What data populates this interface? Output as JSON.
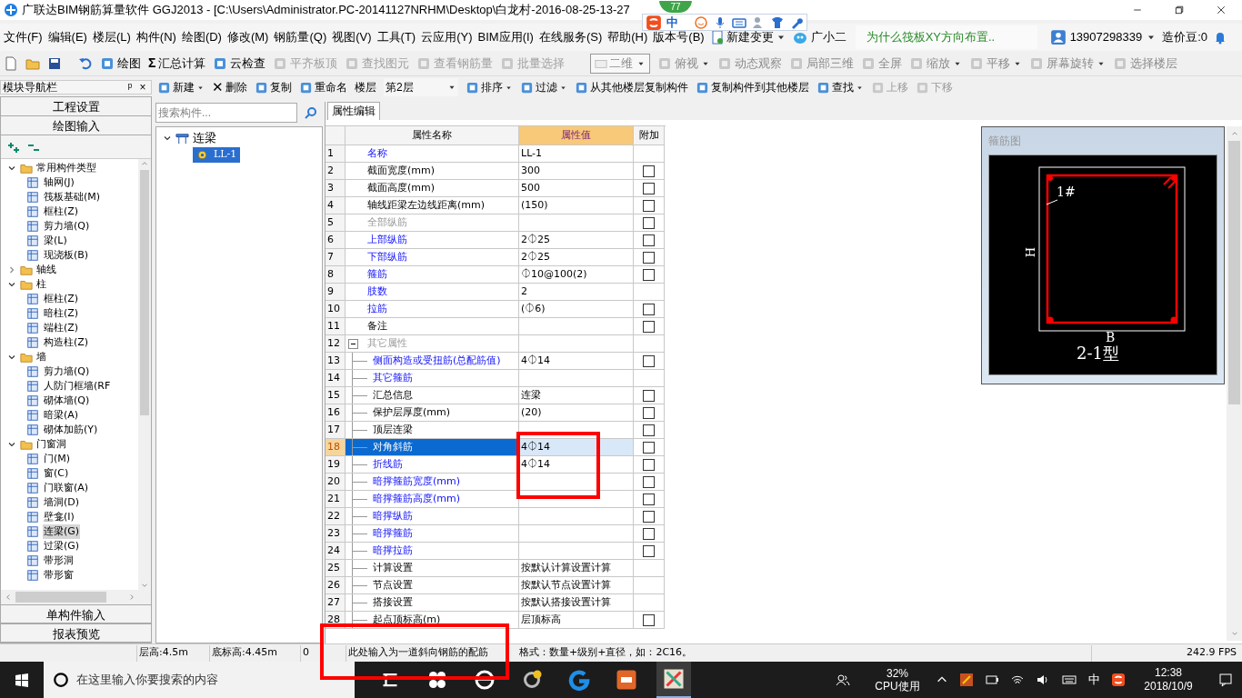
{
  "window": {
    "title": "广联达BIM钢筋算量软件 GGJ2013 - [C:\\Users\\Administrator.PC-20141127NRHM\\Desktop\\白龙村-2016-08-25-13-27"
  },
  "ime_bar": {
    "mode": "中",
    "badge": "77"
  },
  "menu": [
    {
      "label": "文件(F)"
    },
    {
      "label": "编辑(E)"
    },
    {
      "label": "楼层(L)"
    },
    {
      "label": "构件(N)"
    },
    {
      "label": "绘图(D)"
    },
    {
      "label": "修改(M)"
    },
    {
      "label": "钢筋量(Q)"
    },
    {
      "label": "视图(V)"
    },
    {
      "label": "工具(T)"
    },
    {
      "label": "云应用(Y)"
    },
    {
      "label": "BIM应用(I)"
    },
    {
      "label": "在线服务(S)"
    },
    {
      "label": "帮助(H)"
    },
    {
      "label": "版本号(B)"
    }
  ],
  "menu_extra": {
    "change": "新建变更",
    "assistant": "广小二",
    "news": "为什么筏板XY方向布置..",
    "account": "13907298339",
    "beans": "造价豆:0"
  },
  "toolbar": [
    {
      "label": "绘图",
      "disabled": false
    },
    {
      "label": "汇总计算",
      "glyph": "Σ",
      "disabled": false
    },
    {
      "label": "云检查",
      "disabled": false
    },
    {
      "label": "平齐板顶",
      "disabled": true
    },
    {
      "label": "查找图元",
      "disabled": true
    },
    {
      "label": "查看钢筋量",
      "disabled": true
    },
    {
      "label": "批量选择",
      "disabled": true
    }
  ],
  "view_toolbar": {
    "view_mode": "二维",
    "items": [
      {
        "label": "俯视",
        "dropdown": true
      },
      {
        "label": "动态观察",
        "dropdown": false
      },
      {
        "label": "局部三维",
        "dropdown": false
      },
      {
        "label": "全屏",
        "dropdown": false
      },
      {
        "label": "缩放",
        "dropdown": true
      },
      {
        "label": "平移",
        "dropdown": true
      },
      {
        "label": "屏幕旋转",
        "dropdown": true
      },
      {
        "label": "选择楼层",
        "dropdown": false
      }
    ]
  },
  "component_toolbar": [
    {
      "kind": "button",
      "label": "新建",
      "dropdown": true,
      "disabled": false
    },
    {
      "kind": "button",
      "label": "删除",
      "glyph": "✕",
      "dropdown": false,
      "disabled": false
    },
    {
      "kind": "button",
      "label": "复制",
      "dropdown": false,
      "disabled": false
    },
    {
      "kind": "button",
      "label": "重命名",
      "dropdown": false,
      "disabled": false
    },
    {
      "kind": "floor",
      "label": "楼层",
      "value": "第2层"
    },
    {
      "kind": "button",
      "label": "排序",
      "dropdown": true,
      "disabled": false
    },
    {
      "kind": "button",
      "label": "过滤",
      "dropdown": true,
      "disabled": false
    },
    {
      "kind": "button",
      "label": "从其他楼层复制构件",
      "dropdown": false,
      "disabled": false
    },
    {
      "kind": "button",
      "label": "复制构件到其他楼层",
      "dropdown": false,
      "disabled": false
    },
    {
      "kind": "button",
      "label": "查找",
      "dropdown": true,
      "disabled": false
    },
    {
      "kind": "button",
      "label": "上移",
      "dropdown": false,
      "disabled": true
    },
    {
      "kind": "button",
      "label": "下移",
      "dropdown": false,
      "disabled": true
    }
  ],
  "nav": {
    "title": "模块导航栏",
    "pin": "ᵖ",
    "close": "×",
    "top_buttons": [
      "工程设置",
      "绘图输入"
    ],
    "bottom_buttons": [
      "单构件输入",
      "报表预览"
    ],
    "tree": [
      {
        "label": "常用构件类型",
        "expanded": true,
        "selected": false,
        "children": [
          {
            "label": "轴网(J)",
            "selected": false
          },
          {
            "label": "筏板基础(M)",
            "selected": false
          },
          {
            "label": "框柱(Z)",
            "selected": false
          },
          {
            "label": "剪力墙(Q)",
            "selected": false
          },
          {
            "label": "梁(L)",
            "selected": false
          },
          {
            "label": "现浇板(B)",
            "selected": false
          }
        ]
      },
      {
        "label": "轴线",
        "expanded": false,
        "selected": false
      },
      {
        "label": "柱",
        "expanded": true,
        "selected": false,
        "children": [
          {
            "label": "框柱(Z)",
            "selected": false
          },
          {
            "label": "暗柱(Z)",
            "selected": false
          },
          {
            "label": "端柱(Z)",
            "selected": false
          },
          {
            "label": "构造柱(Z)",
            "selected": false
          }
        ]
      },
      {
        "label": "墙",
        "expanded": true,
        "selected": false,
        "children": [
          {
            "label": "剪力墙(Q)",
            "selected": false
          },
          {
            "label": "人防门框墙(RF",
            "selected": false
          },
          {
            "label": "砌体墙(Q)",
            "selected": false
          },
          {
            "label": "暗梁(A)",
            "selected": false
          },
          {
            "label": "砌体加筋(Y)",
            "selected": false
          }
        ]
      },
      {
        "label": "门窗洞",
        "expanded": true,
        "selected": false,
        "children": [
          {
            "label": "门(M)",
            "selected": false
          },
          {
            "label": "窗(C)",
            "selected": false
          },
          {
            "label": "门联窗(A)",
            "selected": false
          },
          {
            "label": "墙洞(D)",
            "selected": false
          },
          {
            "label": "壁龛(I)",
            "selected": false
          },
          {
            "label": "连梁(G)",
            "selected": true
          },
          {
            "label": "过梁(G)",
            "selected": false
          },
          {
            "label": "带形洞",
            "selected": false
          },
          {
            "label": "带形窗",
            "selected": false
          }
        ]
      }
    ]
  },
  "components": {
    "search": {
      "placeholder": "搜索构件..."
    },
    "tree": [
      {
        "label": "连梁",
        "expanded": true,
        "selected": false,
        "children": [
          {
            "label": "LL-1",
            "selected": true
          }
        ]
      }
    ]
  },
  "properties": {
    "tab": "属性编辑",
    "columns": [
      "属性名称",
      "属性值",
      "附加"
    ],
    "rows": [
      {
        "num": "1",
        "name": "名称",
        "kind": "link",
        "value": "LL-1",
        "selected": false
      },
      {
        "num": "2",
        "name": "截面宽度(mm)",
        "kind": "plain",
        "value": "300",
        "checked": false,
        "selected": false
      },
      {
        "num": "3",
        "name": "截面高度(mm)",
        "kind": "plain",
        "value": "500",
        "checked": false,
        "selected": false
      },
      {
        "num": "4",
        "name": "轴线距梁左边线距离(mm)",
        "kind": "plain",
        "value": "(150)",
        "checked": false,
        "selected": false
      },
      {
        "num": "5",
        "name": "全部纵筋",
        "kind": "muted",
        "checked": false,
        "selected": false
      },
      {
        "num": "6",
        "name": "上部纵筋",
        "kind": "link",
        "value": "2⏀25",
        "checked": false,
        "selected": false
      },
      {
        "num": "7",
        "name": "下部纵筋",
        "kind": "link",
        "value": "2⏀25",
        "checked": false,
        "selected": false
      },
      {
        "num": "8",
        "name": "箍筋",
        "kind": "link",
        "value": "⏀10@100(2)",
        "checked": false,
        "selected": false
      },
      {
        "num": "9",
        "name": "肢数",
        "kind": "link",
        "value": "2",
        "selected": false
      },
      {
        "num": "10",
        "name": "拉筋",
        "kind": "link",
        "value": "(⏀6)",
        "checked": false,
        "selected": false
      },
      {
        "num": "11",
        "name": "备注",
        "kind": "plain",
        "checked": false,
        "selected": false
      },
      {
        "num": "12",
        "name": "其它属性",
        "kind": "muted",
        "expanded": true,
        "selected": false,
        "children": [
          {
            "num": "13",
            "name": "侧面构造或受扭筋(总配筋值)",
            "kind": "link",
            "value": "4⏀14",
            "checked": false,
            "selected": false
          },
          {
            "num": "14",
            "name": "其它箍筋",
            "kind": "link",
            "selected": false
          },
          {
            "num": "15",
            "name": "汇总信息",
            "kind": "plain",
            "value": "连梁",
            "checked": false,
            "selected": false
          },
          {
            "num": "16",
            "name": "保护层厚度(mm)",
            "kind": "plain",
            "value": "(20)",
            "checked": false,
            "selected": false
          },
          {
            "num": "17",
            "name": "顶层连梁",
            "kind": "plain",
            "checked": false,
            "selected": false
          },
          {
            "num": "18",
            "name": "对角斜筋",
            "kind": "link",
            "value": "4⏀14",
            "checked": false,
            "selected": true
          },
          {
            "num": "19",
            "name": "折线筋",
            "kind": "link",
            "value": "4⏀14",
            "checked": false,
            "selected": false
          },
          {
            "num": "20",
            "name": "暗撑箍筋宽度(mm)",
            "kind": "link",
            "checked": false,
            "selected": false
          },
          {
            "num": "21",
            "name": "暗撑箍筋高度(mm)",
            "kind": "link",
            "checked": false,
            "selected": false
          },
          {
            "num": "22",
            "name": "暗撑纵筋",
            "kind": "link",
            "checked": false,
            "selected": false
          },
          {
            "num": "23",
            "name": "暗撑箍筋",
            "kind": "link",
            "checked": false,
            "selected": false
          },
          {
            "num": "24",
            "name": "暗撑拉筋",
            "kind": "link",
            "checked": false,
            "selected": false
          },
          {
            "num": "25",
            "name": "计算设置",
            "kind": "plain",
            "value": "按默认计算设置计算",
            "selected": false
          },
          {
            "num": "26",
            "name": "节点设置",
            "kind": "plain",
            "value": "按默认节点设置计算",
            "selected": false
          },
          {
            "num": "27",
            "name": "搭接设置",
            "kind": "plain",
            "value": "按默认搭接设置计算",
            "selected": false
          },
          {
            "num": "28",
            "name": "起点顶标高(m)",
            "kind": "plain",
            "value": "层顶标高",
            "checked": false,
            "selected": false
          }
        ]
      }
    ]
  },
  "stirrup": {
    "title": "箍筋图",
    "mark": "1#",
    "height_label": "H",
    "width_label": "B",
    "type": "2-1型"
  },
  "status_bar": [
    "层高:4.5m",
    "底标高:4.45m",
    "0",
    [
      "此处输入为一道斜向钢筋的配筋",
      "格式：数量+级别+直径，如：2C16。"
    ],
    "242.9 FPS"
  ],
  "taskbar": {
    "search": {
      "placeholder": "在这里输入你要搜索的内容"
    },
    "cpu": "32%",
    "cpu_label": "CPU使用",
    "ime": "中",
    "time": "12:38",
    "date": "2018/10/9"
  }
}
